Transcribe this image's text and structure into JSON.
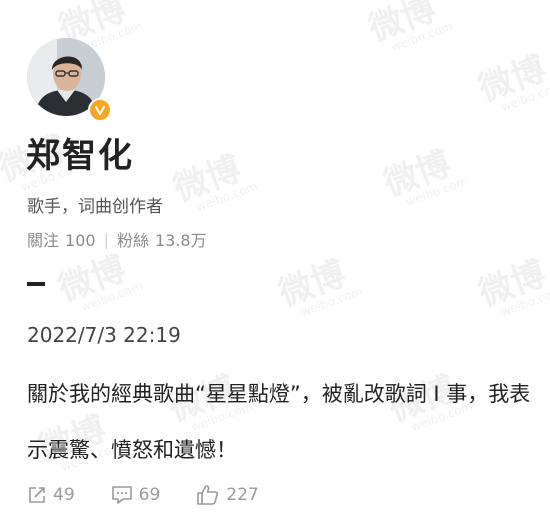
{
  "profile": {
    "name": "郑智化",
    "bio": "歌手，词曲创作者",
    "following_label": "關注",
    "following_count": "100",
    "followers_label": "粉絲",
    "followers_count": "13.8万",
    "verified_badge_color": "#f5a623"
  },
  "post": {
    "date": "2022/7/3 22:19",
    "text": "關於我的經典歌曲“星星點燈”，被亂改歌詞 I 事，我表示震驚、憤怒和遺憾！"
  },
  "actions": {
    "repost_count": "49",
    "comment_count": "69",
    "like_count": "227"
  },
  "watermark": {
    "logo_text": "微博",
    "site_text": "weibo.com"
  }
}
